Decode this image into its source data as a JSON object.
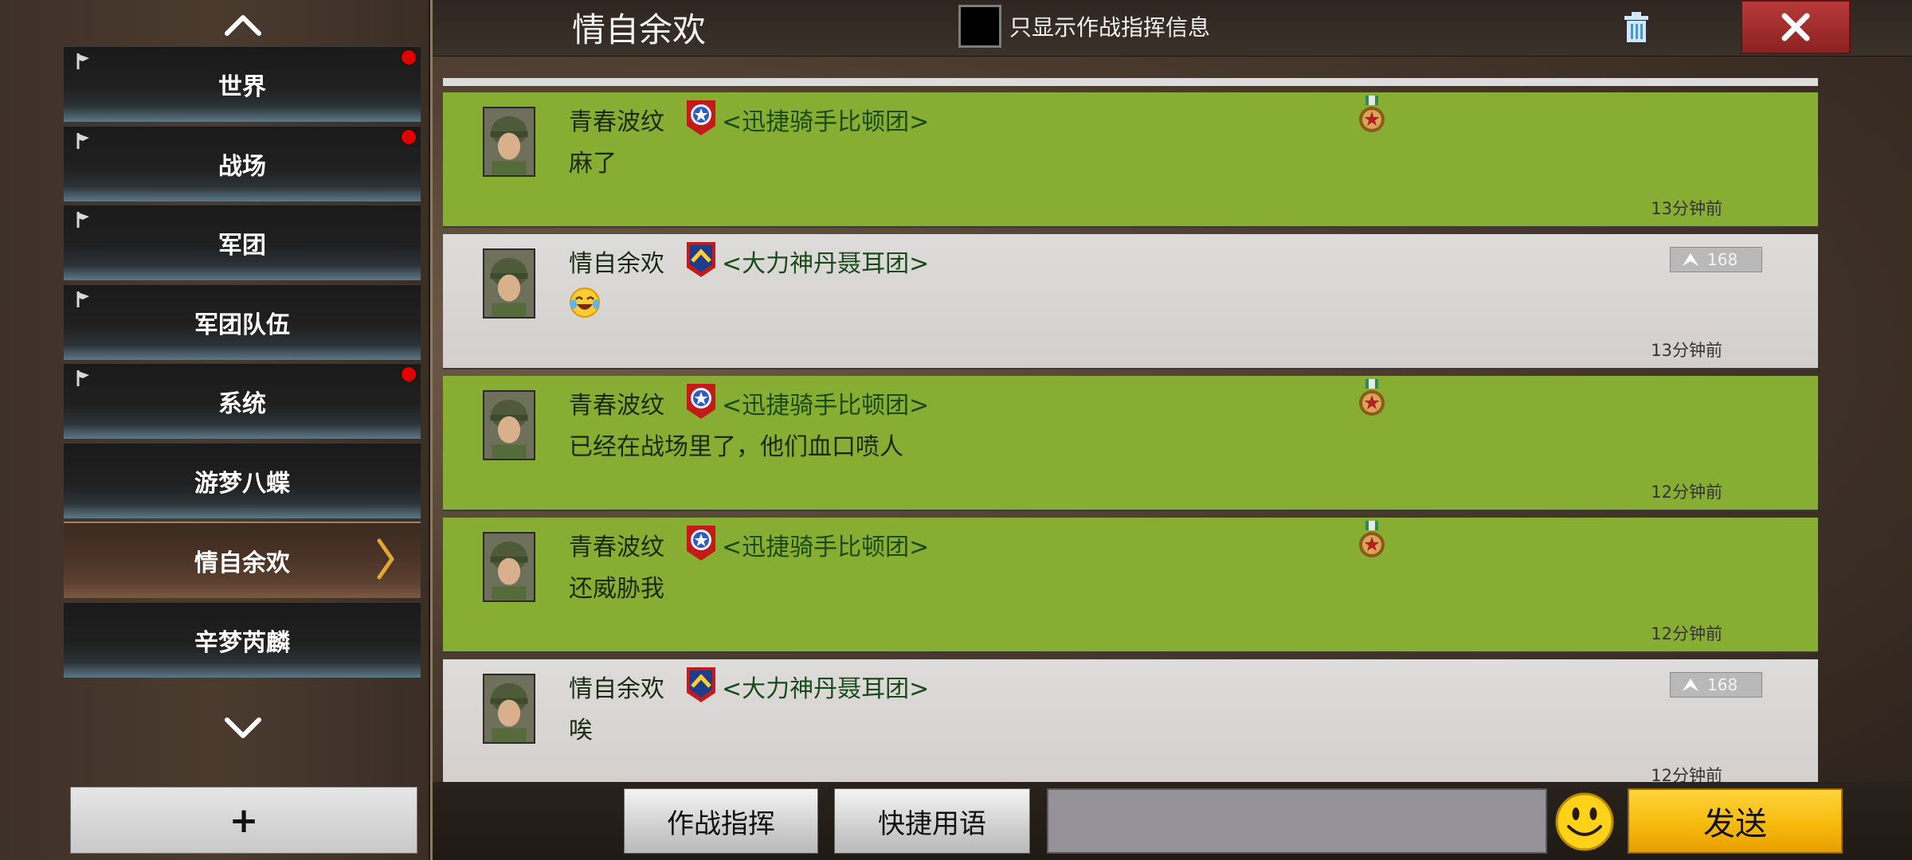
{
  "sidebar": {
    "items": [
      {
        "label": "世界",
        "pinned": true,
        "unread": true,
        "active": false
      },
      {
        "label": "战场",
        "pinned": true,
        "unread": true,
        "active": false
      },
      {
        "label": "军团",
        "pinned": true,
        "unread": false,
        "active": false
      },
      {
        "label": "军团队伍",
        "pinned": true,
        "unread": false,
        "active": false
      },
      {
        "label": "系统",
        "pinned": true,
        "unread": true,
        "active": false
      },
      {
        "label": "游梦八蝶",
        "pinned": false,
        "unread": false,
        "active": false
      },
      {
        "label": "情自余欢",
        "pinned": false,
        "unread": false,
        "active": true
      },
      {
        "label": "辛梦芮麟",
        "pinned": false,
        "unread": false,
        "active": false
      }
    ],
    "add_label": "+"
  },
  "header": {
    "title": "情自余欢",
    "filter_label": "只显示作战指挥信息",
    "filter_checked": false
  },
  "messages": [
    {
      "sender": "青春波纹",
      "guild": "<迅捷骑手比顿团>",
      "text": "麻了",
      "time": "13分钟前",
      "style": "green",
      "badge": "star-shield-icon",
      "medal": true
    },
    {
      "sender": "情自余欢",
      "guild": "<大力神丹聂耳团>",
      "text": "",
      "emoji": "tears-of-joy-emoji",
      "time": "13分钟前",
      "style": "gray",
      "badge": "chevron-shield-icon",
      "rank": "168"
    },
    {
      "sender": "青春波纹",
      "guild": "<迅捷骑手比顿团>",
      "text": "已经在战场里了，他们血口喷人",
      "time": "12分钟前",
      "style": "green",
      "badge": "star-shield-icon",
      "medal": true
    },
    {
      "sender": "青春波纹",
      "guild": "<迅捷骑手比顿团>",
      "text": "还威胁我",
      "time": "12分钟前",
      "style": "green",
      "badge": "star-shield-icon",
      "medal": true
    },
    {
      "sender": "情自余欢",
      "guild": "<大力神丹聂耳团>",
      "text": "唉",
      "time": "12分钟前",
      "style": "gray",
      "badge": "chevron-shield-icon",
      "rank": "168"
    }
  ],
  "bottom": {
    "command_label": "作战指挥",
    "quick_label": "快捷用语",
    "input_value": "",
    "input_placeholder": "",
    "send_label": "发送"
  },
  "colors": {
    "green_row": "#87ad32",
    "gray_row": "#d8d6d3",
    "send_yellow": "#f5b80a",
    "close_red": "#a82c2c"
  }
}
